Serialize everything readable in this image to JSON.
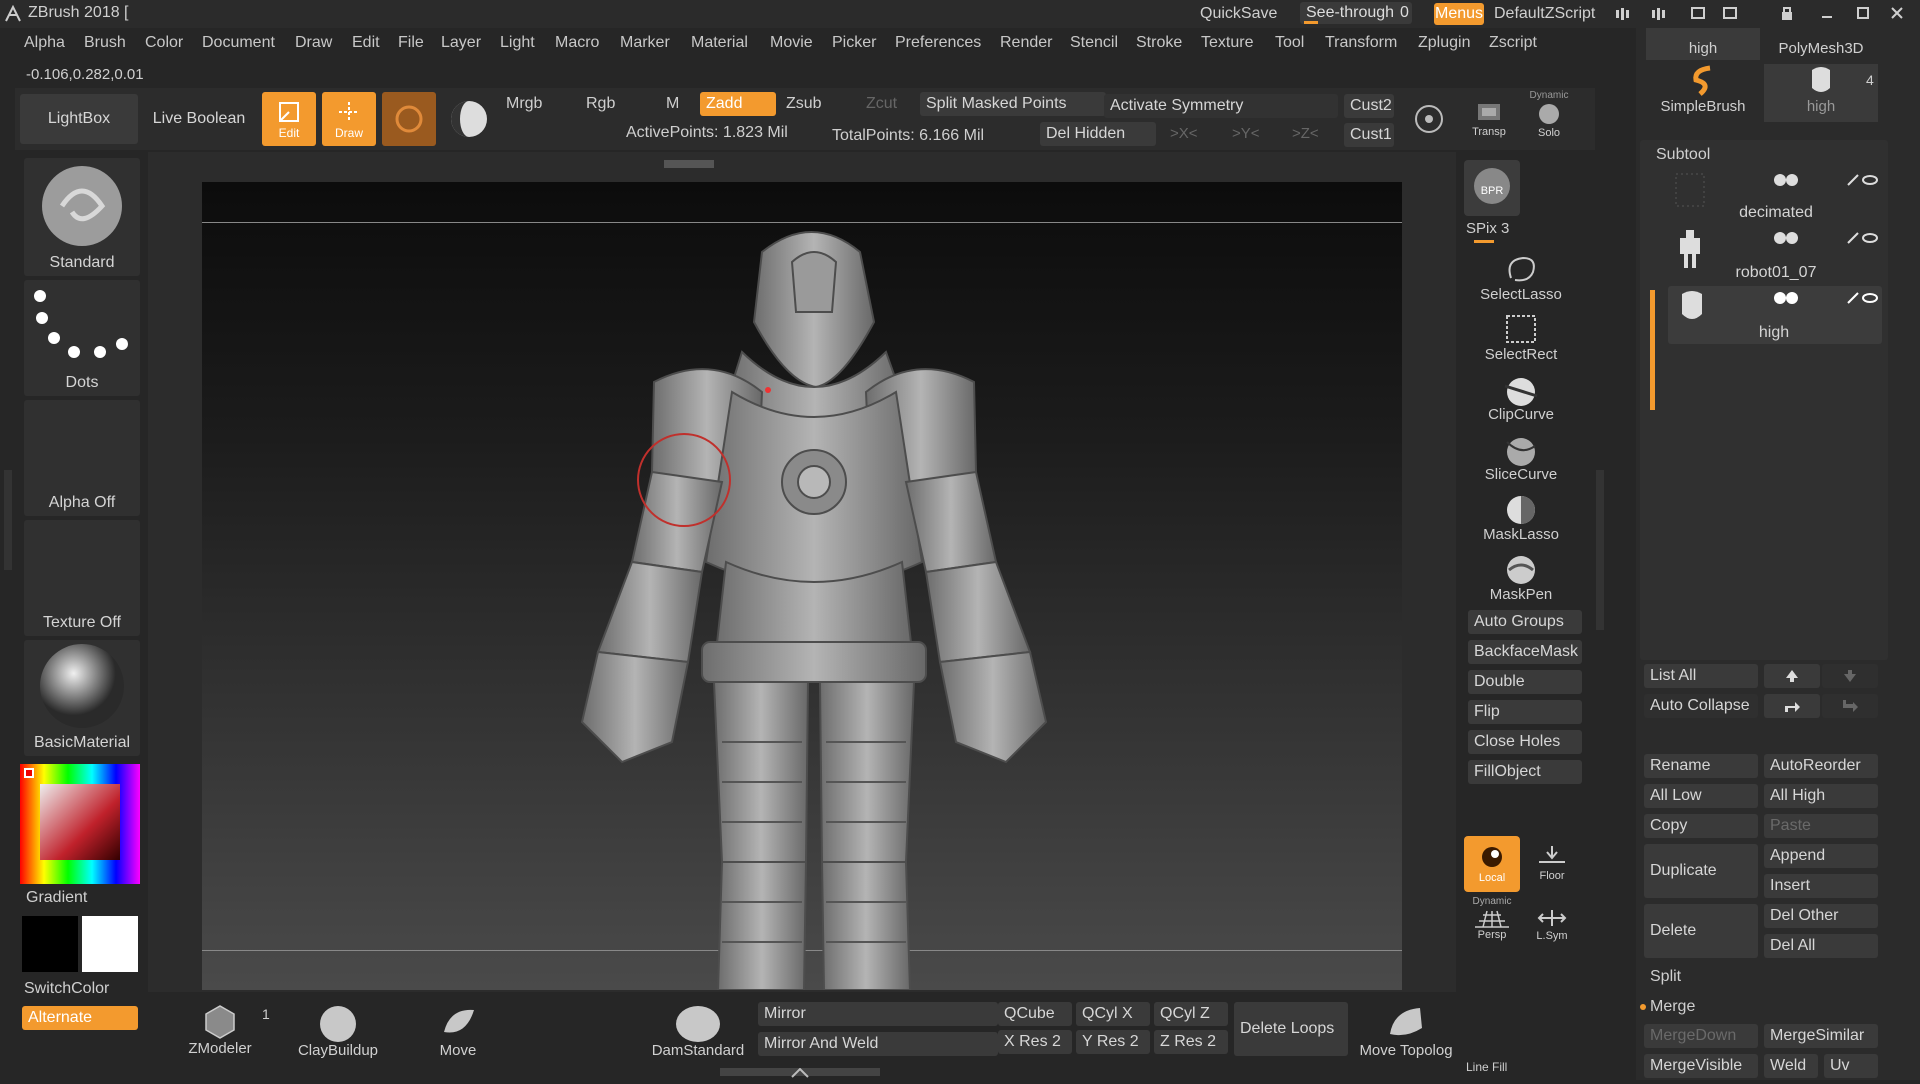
{
  "titlebar": {
    "title": "ZBrush 2018 [",
    "quicksave": "QuickSave",
    "seethrough": "See-through",
    "seethrough_value": "0",
    "menus": "Menus",
    "script": "DefaultZScript"
  },
  "menubar": [
    "Alpha",
    "Brush",
    "Color",
    "Document",
    "Draw",
    "Edit",
    "File",
    "Layer",
    "Light",
    "Macro",
    "Marker",
    "Material",
    "Movie",
    "Picker",
    "Preferences",
    "Render",
    "Stencil",
    "Stroke",
    "Texture",
    "Tool",
    "Transform",
    "Zplugin",
    "Zscript"
  ],
  "coords": "-0.106,0.282,0.01",
  "toolbar": {
    "lightbox": "LightBox",
    "live_boolean": "Live Boolean",
    "edit": "Edit",
    "draw": "Draw",
    "mrgb": "Mrgb",
    "rgb": "Rgb",
    "m": "M",
    "zadd": "Zadd",
    "zsub": "Zsub",
    "zcut": "Zcut",
    "split_masked": "Split Masked Points",
    "activate_symmetry": "Activate Symmetry",
    "cust2": "Cust2",
    "cust1": "Cust1",
    "del_hidden": "Del Hidden",
    "x": ">X<",
    "y": ">Y<",
    "z": ">Z<",
    "active_points": "ActivePoints: 1.823 Mil",
    "total_points": "TotalPoints: 6.166 Mil",
    "transp": "Transp",
    "dynamic": "Dynamic",
    "solo": "Solo"
  },
  "left_shelf": {
    "brush": "Standard",
    "stroke": "Dots",
    "alpha": "Alpha Off",
    "texture": "Texture Off",
    "material": "BasicMaterial",
    "gradient": "Gradient",
    "switchcolor": "SwitchColor",
    "alternate": "Alternate"
  },
  "right_shelf": {
    "bpr": "BPR",
    "spix": "SPix 3",
    "tools": [
      "SelectLasso",
      "SelectRect",
      "ClipCurve",
      "SliceCurve",
      "MaskLasso",
      "MaskPen"
    ],
    "buttons": [
      "Auto Groups",
      "BackfaceMask",
      "Double",
      "Flip",
      "Close Holes",
      "FillObject"
    ],
    "local": "Local",
    "floor": "Floor",
    "persp": "Persp",
    "lsym": "L.Sym",
    "dynamic": "Dynamic"
  },
  "bottom_bar": {
    "zmodeler": "ZModeler",
    "zmodeler_count": "1",
    "claybuildup": "ClayBuildup",
    "move": "Move",
    "damstandard": "DamStandard",
    "mirror": "Mirror",
    "mirror_weld": "Mirror And Weld",
    "qcube": "QCube",
    "qcylx": "QCyl X",
    "qcylz": "QCyl Z",
    "xres": "X Res 2",
    "yres": "Y Res 2",
    "zres": "Z Res 2",
    "delete_loops": "Delete Loops",
    "move_topolog": "Move Topolog",
    "line_fill": "Line Fill"
  },
  "tool_panel": {
    "top_thumbs": [
      "high",
      "PolyMesh3D",
      "SimpleBrush",
      "high"
    ],
    "top_count": "4",
    "subtool_title": "Subtool",
    "subtools": [
      "decimated",
      "robot01_07",
      "high"
    ],
    "list_all": "List All",
    "auto_collapse": "Auto Collapse",
    "rename": "Rename",
    "autoreorder": "AutoReorder",
    "all_low": "All Low",
    "all_high": "All High",
    "copy": "Copy",
    "paste": "Paste",
    "duplicate": "Duplicate",
    "append": "Append",
    "insert": "Insert",
    "delete": "Delete",
    "del_other": "Del Other",
    "del_all": "Del All",
    "split": "Split",
    "merge": "Merge",
    "mergedown": "MergeDown",
    "mergesimilar": "MergeSimilar",
    "mergevisible": "MergeVisible",
    "weld": "Weld",
    "uv": "Uv"
  }
}
